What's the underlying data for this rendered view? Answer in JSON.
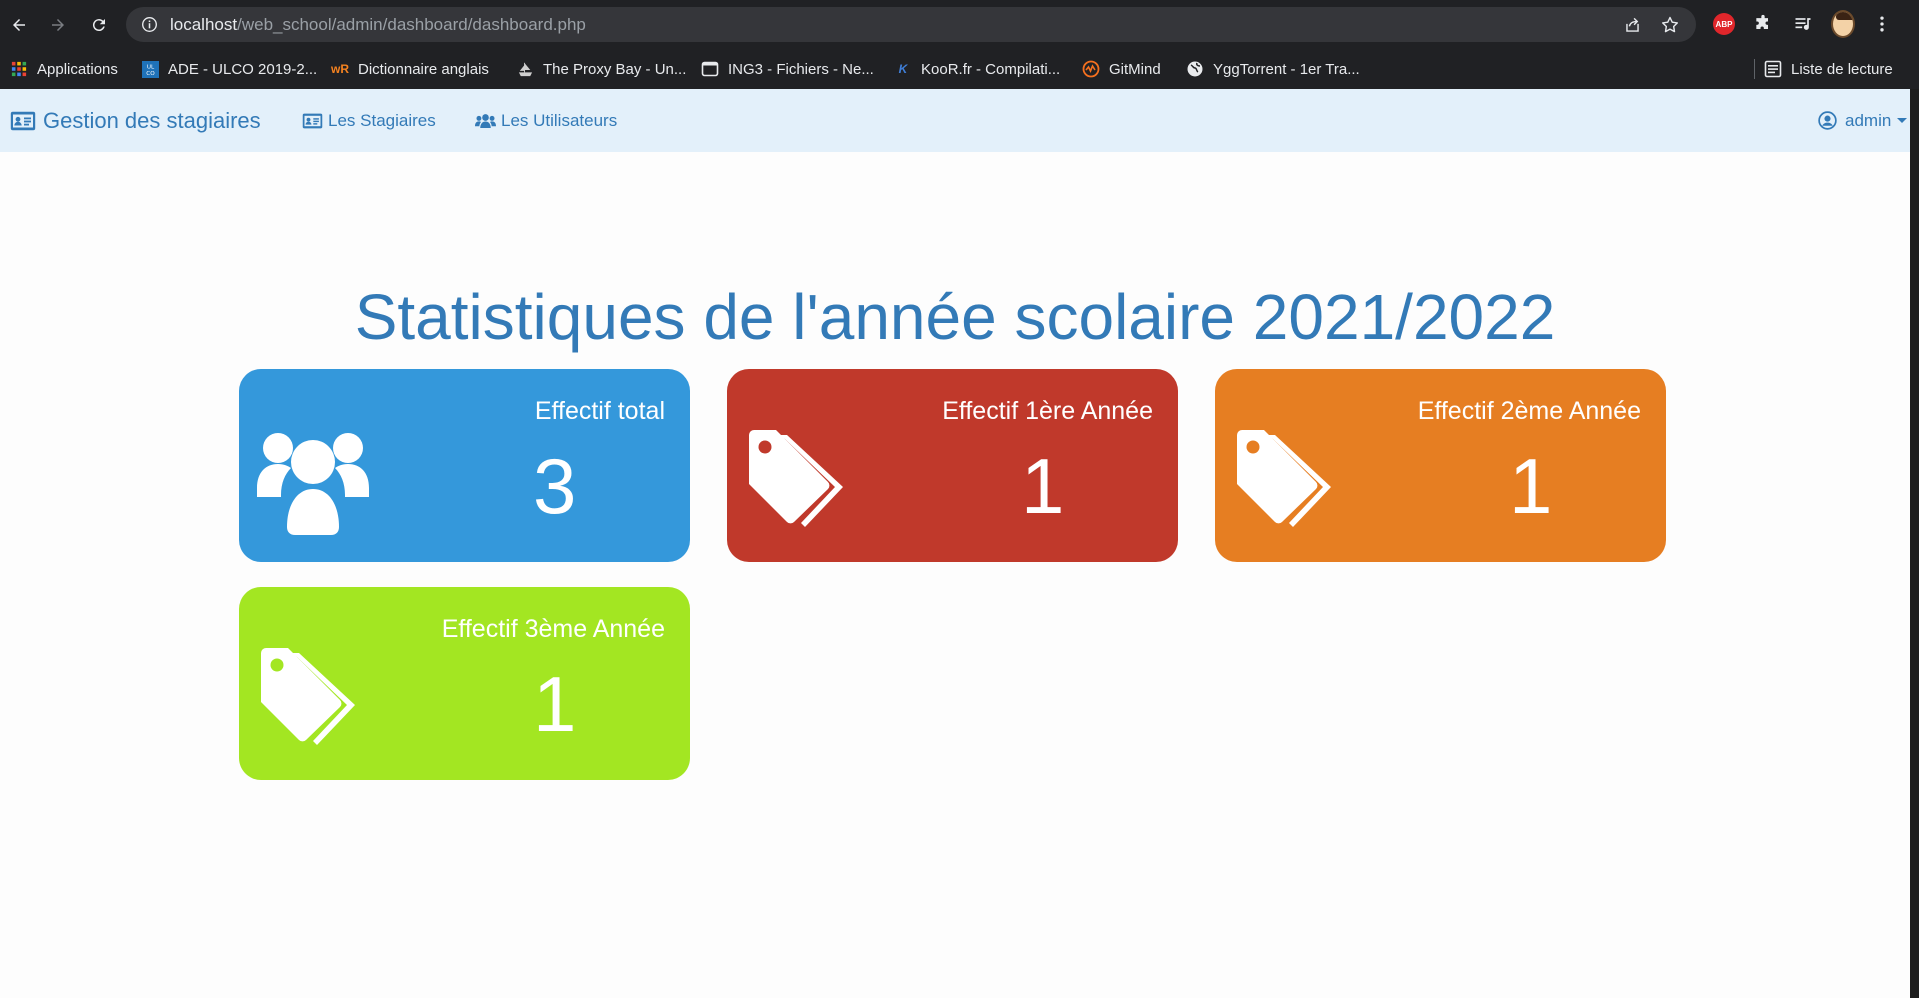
{
  "browser": {
    "url_host": "localhost",
    "url_path": "/web_school/admin/dashboard/dashboard.php",
    "bookmarks": [
      {
        "label": "Applications",
        "icon": "apps-grid-icon"
      },
      {
        "label": "ADE - ULCO 2019-2...",
        "icon": "ulco-icon"
      },
      {
        "label": "Dictionnaire anglais",
        "icon": "wordreference-icon"
      },
      {
        "label": "The Proxy Bay - Un...",
        "icon": "pirate-ship-icon"
      },
      {
        "label": "ING3 - Fichiers - Ne...",
        "icon": "folder-icon"
      },
      {
        "label": "KooR.fr - Compilati...",
        "icon": "koor-icon"
      },
      {
        "label": "GitMind",
        "icon": "gitmind-icon"
      },
      {
        "label": "YggTorrent - 1er Tra...",
        "icon": "globe-icon"
      }
    ],
    "reading_list": "Liste de lecture"
  },
  "navbar": {
    "brand": "Gestion des stagiaires",
    "links": [
      {
        "label": "Les Stagiaires",
        "icon": "id-card-icon"
      },
      {
        "label": "Les Utilisateurs",
        "icon": "users-icon"
      }
    ],
    "user": "admin"
  },
  "main": {
    "title": "Statistiques de l'année scolaire 2021/2022",
    "cards": [
      {
        "label": "Effectif total",
        "value": "3",
        "color": "#3498db",
        "icon": "users-icon"
      },
      {
        "label": "Effectif 1ère Année",
        "value": "1",
        "color": "#c0392b",
        "icon": "tags-icon"
      },
      {
        "label": "Effectif 2ème Année",
        "value": "1",
        "color": "#e67e22",
        "icon": "tags-icon"
      },
      {
        "label": "Effectif 3ème Année",
        "value": "1",
        "color": "#a3e622",
        "icon": "tags-icon"
      }
    ]
  }
}
